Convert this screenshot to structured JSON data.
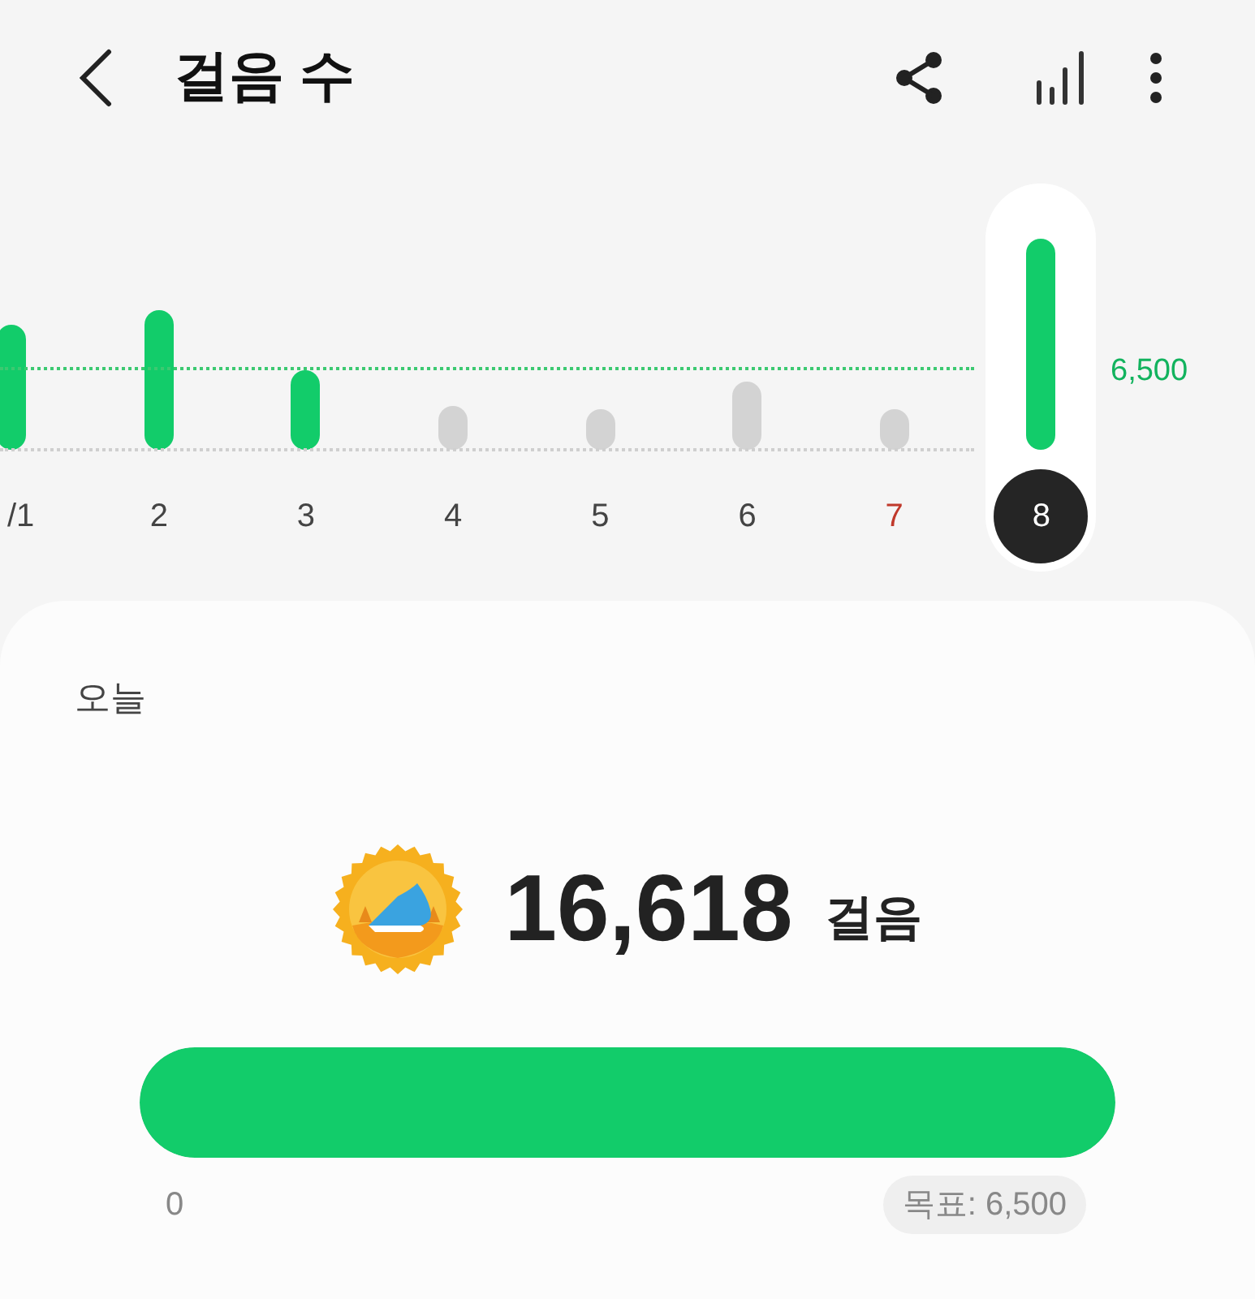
{
  "header": {
    "title": "걸음 수"
  },
  "chart": {
    "goal_label": "6,500",
    "days": [
      {
        "label": "/1",
        "active": true,
        "selected": false
      },
      {
        "label": "2",
        "active": true,
        "selected": false
      },
      {
        "label": "3",
        "active": true,
        "selected": false
      },
      {
        "label": "4",
        "active": false,
        "selected": false
      },
      {
        "label": "5",
        "active": false,
        "selected": false
      },
      {
        "label": "6",
        "active": false,
        "selected": false
      },
      {
        "label": "7",
        "active": false,
        "selected": false,
        "color": "#c0392b"
      },
      {
        "label": "8",
        "active": true,
        "selected": true
      }
    ]
  },
  "today": {
    "heading": "오늘",
    "count": "16,618",
    "unit": "걸음",
    "progress": {
      "level": 1.0,
      "start_label": "0",
      "goal_label": "목표: 6,500"
    }
  }
}
